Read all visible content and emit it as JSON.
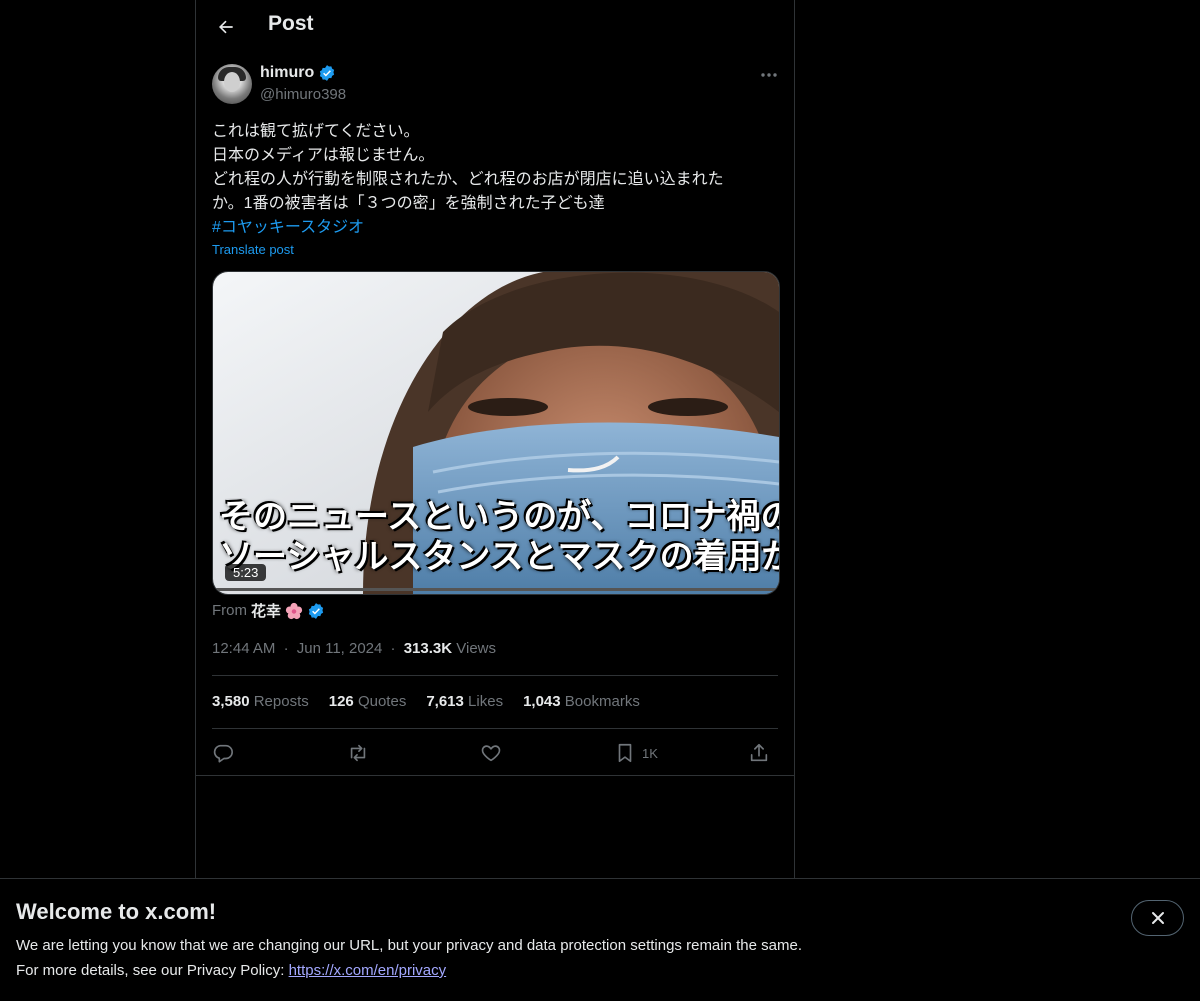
{
  "header": {
    "title": "Post"
  },
  "author": {
    "name": "himuro",
    "handle": "@himuro398"
  },
  "post": {
    "lines": [
      "これは観て拡げてください。",
      "日本のメディアは報じません。",
      "どれ程の人が行動を制限されたか、どれ程のお店が閉店に追い込まれた",
      "か。1番の被害者は「３つの密」を強制された子ども達"
    ],
    "hashtag": "#コヤッキースタジオ",
    "translate": "Translate post"
  },
  "video": {
    "subtitle_1": "そのニュースというのが、コロナ禍の",
    "subtitle_2": "ソーシャルスタンスとマスクの着用が",
    "duration": "5:23",
    "progress": 0.005
  },
  "from": {
    "label": "From",
    "source": "花幸"
  },
  "meta": {
    "time": "12:44 AM",
    "sep": "·",
    "date": "Jun 11, 2024",
    "views": "313.3K",
    "views_label": "Views"
  },
  "stats": {
    "reposts": "3,580",
    "reposts_label": "Reposts",
    "quotes": "126",
    "quotes_label": "Quotes",
    "likes": "7,613",
    "likes_label": "Likes",
    "bookmarks": "1,043",
    "bookmarks_label": "Bookmarks"
  },
  "actions": {
    "bookmark_count": "1K"
  },
  "banner": {
    "title": "Welcome to x.com!",
    "line1": "We are letting you know that we are changing our URL, but your privacy and data protection settings remain the same.",
    "line2_prefix": "For more details, see our Privacy Policy: ",
    "link": "https://x.com/en/privacy"
  },
  "colors": {
    "accent": "#1d9bf0",
    "background": "#000000",
    "muted": "#71767b",
    "border": "#2f3336"
  }
}
